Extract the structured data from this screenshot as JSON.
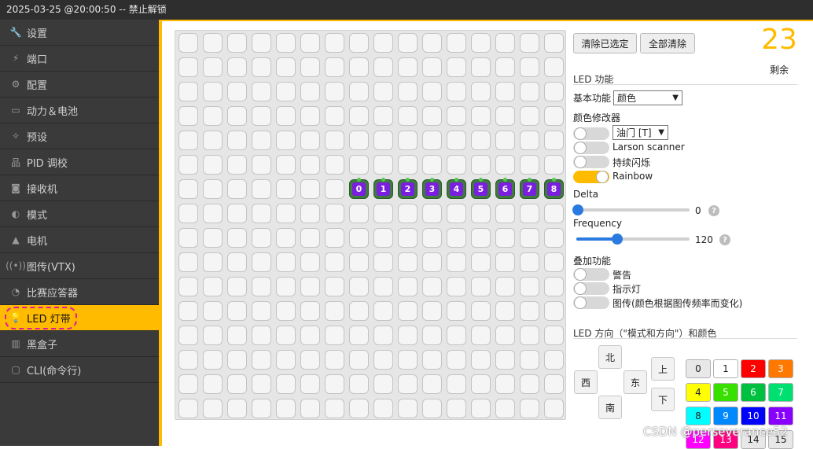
{
  "topbar": {
    "title": "2025-03-25 @20:00:50 -- 禁止解锁"
  },
  "sidebar": {
    "items": [
      {
        "label": "设置",
        "icon": "wrench-icon",
        "glyph": "🔧"
      },
      {
        "label": "端口",
        "icon": "plug-icon",
        "glyph": "⚡"
      },
      {
        "label": "配置",
        "icon": "gear-icon",
        "glyph": "⚙"
      },
      {
        "label": "动力＆电池",
        "icon": "battery-icon",
        "glyph": "▭"
      },
      {
        "label": "预设",
        "icon": "wand-icon",
        "glyph": "✧"
      },
      {
        "label": "PID 调校",
        "icon": "sitemap-icon",
        "glyph": "品"
      },
      {
        "label": "接收机",
        "icon": "robot-icon",
        "glyph": "◙"
      },
      {
        "label": "模式",
        "icon": "toggle-icon",
        "glyph": "◐"
      },
      {
        "label": "电机",
        "icon": "motor-icon",
        "glyph": "▲"
      },
      {
        "label": "图传(VTX)",
        "icon": "broadcast-icon",
        "glyph": "((•))"
      },
      {
        "label": "比赛应答器",
        "icon": "satellite-icon",
        "glyph": "◔"
      },
      {
        "label": "LED 灯带",
        "icon": "bulb-icon",
        "glyph": "💡",
        "active": true
      },
      {
        "label": "黑盒子",
        "icon": "barcode-icon",
        "glyph": "▥"
      },
      {
        "label": "CLI(命令行)",
        "icon": "terminal-icon",
        "glyph": "▢"
      }
    ]
  },
  "grid": {
    "rows": 16,
    "cols": 16,
    "leds": [
      {
        "row": 6,
        "col": 7,
        "label": "0"
      },
      {
        "row": 6,
        "col": 8,
        "label": "1"
      },
      {
        "row": 6,
        "col": 9,
        "label": "2"
      },
      {
        "row": 6,
        "col": 10,
        "label": "3"
      },
      {
        "row": 6,
        "col": 11,
        "label": "4"
      },
      {
        "row": 6,
        "col": 12,
        "label": "5"
      },
      {
        "row": 6,
        "col": 13,
        "label": "6"
      },
      {
        "row": 6,
        "col": 14,
        "label": "7"
      },
      {
        "row": 6,
        "col": 15,
        "label": "8"
      }
    ]
  },
  "panel": {
    "clear_selected": "清除已选定",
    "clear_all": "全部清除",
    "remaining_count": "23",
    "remaining_label": "剩余",
    "led_functions_title": "LED 功能",
    "basic_function_label": "基本功能",
    "basic_function_value": "颜色",
    "color_modifier_title": "颜色修改器",
    "throttle_value": "油门 [T]",
    "larson_label": "Larson scanner",
    "blink_label": "持续闪烁",
    "rainbow_label": "Rainbow",
    "delta_label": "Delta",
    "delta_value": "0",
    "delta_fraction": 0.0,
    "frequency_label": "Frequency",
    "frequency_value": "120",
    "frequency_fraction": 0.35,
    "overlay_title": "叠加功能",
    "warning_label": "警告",
    "indicator_label": "指示灯",
    "vtx_label": "图传(颜色根据图传频率而变化)",
    "direction_title": "LED 方向（\"模式和方向\"）和颜色",
    "dir_north": "北",
    "dir_west": "西",
    "dir_east": "东",
    "dir_south": "南",
    "dir_up": "上",
    "dir_down": "下",
    "toggles": {
      "larson": false,
      "blink": false,
      "rainbow": true,
      "warning": false,
      "indicator": false,
      "vtx": false,
      "throttle": false
    },
    "colors": [
      {
        "label": "0",
        "bg": "#e8e8e8",
        "fg": "#222"
      },
      {
        "label": "1",
        "bg": "#ffffff",
        "fg": "#222"
      },
      {
        "label": "2",
        "bg": "#ff0000",
        "fg": "#fff"
      },
      {
        "label": "3",
        "bg": "#ff7800",
        "fg": "#fff"
      },
      {
        "label": "4",
        "bg": "#ffff00",
        "fg": "#222"
      },
      {
        "label": "5",
        "bg": "#38e000",
        "fg": "#fff"
      },
      {
        "label": "6",
        "bg": "#00c040",
        "fg": "#fff"
      },
      {
        "label": "7",
        "bg": "#00e070",
        "fg": "#fff"
      },
      {
        "label": "8",
        "bg": "#00ffff",
        "fg": "#222"
      },
      {
        "label": "9",
        "bg": "#0088ff",
        "fg": "#fff"
      },
      {
        "label": "10",
        "bg": "#0000ff",
        "fg": "#fff"
      },
      {
        "label": "11",
        "bg": "#8800ff",
        "fg": "#fff"
      },
      {
        "label": "12",
        "bg": "#ff00ff",
        "fg": "#fff"
      },
      {
        "label": "13",
        "bg": "#ff0080",
        "fg": "#fff"
      },
      {
        "label": "14",
        "bg": "#e8e8e8",
        "fg": "#222"
      },
      {
        "label": "15",
        "bg": "#e8e8e8",
        "fg": "#222"
      }
    ]
  },
  "watermark": "CSDN @perseverance52"
}
